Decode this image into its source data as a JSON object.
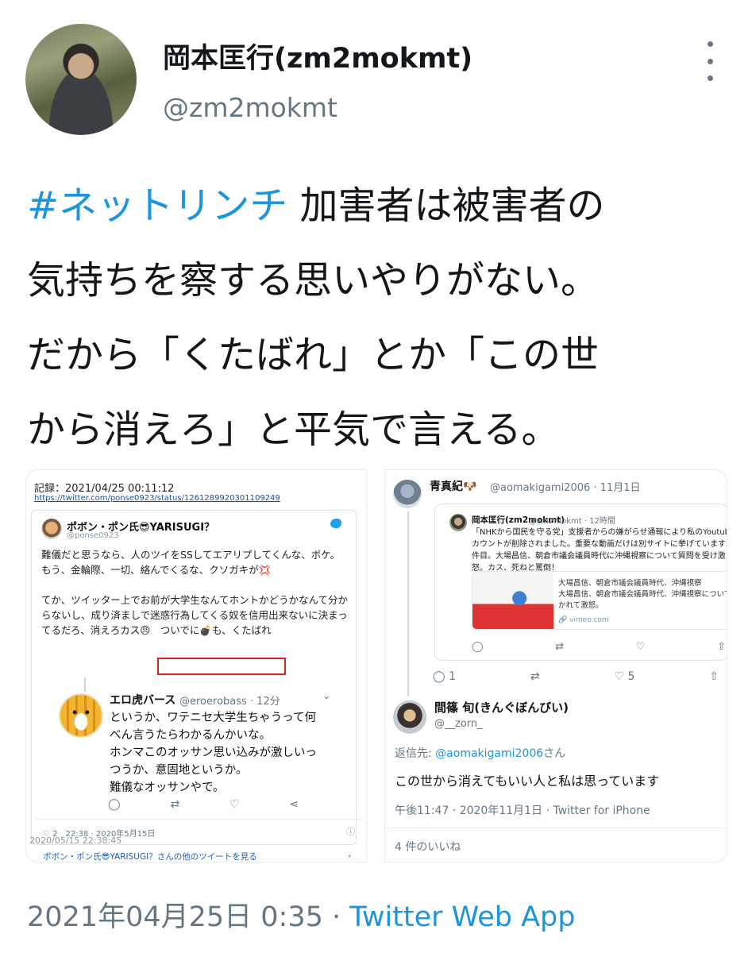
{
  "author": {
    "name": "岡本匡行(zm2mokmt)",
    "handle": "@zm2mokmt"
  },
  "tweet": {
    "hashtag": "#ネットリンチ",
    "lines": [
      " 加害者は被害者の",
      "気持ちを察する思いやりがない。",
      "だから「くたばれ」とか「この世",
      "から消えろ」と平気で言える。"
    ]
  },
  "left_image": {
    "record_title": "記録：2021/04/25 00:11:12",
    "record_url": "https://twitter.com/ponse0923/status/1261289920301109249",
    "pobo_name": "ポボン・ポン氏😎YARISUGI？",
    "pobo_handle": "@ponse0923",
    "pobo_lines": [
      "難儀だと思うなら、人のツイをSSしてエアリプしてくんな、ボケ。",
      "もう、金輪際、一切、絡んでくるな、クソガキが💢",
      "",
      "てか、ツイッター上でお前が大学生なんてホントかどうかなんて分か",
      "らないし、成り済ましで迷惑行為してくる奴を信用出来ないに決まっ",
      "てるだろ、消えろカス😠　ついでに💣も、くたばれ"
    ],
    "ero_name": "エロ虎バース",
    "ero_handle": "@eroerobass · 12分",
    "ero_lines": [
      "というか、ワテニセ大学生ちゃうって何",
      "べん言うたらわかるんかいな。",
      "ホンマこのオッサン思い込みが激しいっ",
      "つうか、意固地というか。",
      "難儀なオッサンやで。"
    ],
    "meta": "♡ 2　22:38 · 2020年5月15日",
    "more_tweets": "ポボン・ポン氏😎YARISUGI？さんの他のツイートを見る",
    "timestamp": "2020/05/15 22:38:45"
  },
  "right_image": {
    "ao_name": "青真紀🐶",
    "ao_handle": "@aomakigami2006 · 11月1日",
    "quote_name": "岡本匡行(zm2mokmt)",
    "quote_handle": "@zm2mokmt · 12時間",
    "quote_lines": [
      "「NHKから国民を守る党」支援者からの嫌がらせ通報により私のYoutube",
      "カウントが削除されました。重要な動画だけは別サイトに挙げています",
      "件目。大場昌信、朝倉市議会議員時代に沖縄視察について質問を受け激",
      "怒。カス、死ねと罵倒！"
    ],
    "link_lines": [
      "大場昌信、朝倉市議会議員時代、沖縄視察",
      "大場昌信、朝倉市議会議員時代、沖縄視察について",
      "かれて激怒。"
    ],
    "link_domain": "🔗 vimeo.com",
    "reply_count": "1",
    "like_count": "5",
    "zorn_name": "間篠 旬(きんぐぼんびい)",
    "zorn_handle": "@__zorn_",
    "reply_prefix": "返信先: ",
    "reply_to": "@aomakigami2006",
    "reply_suffix": "さん",
    "zorn_body": "この世から消えてもいい人と私は思っています",
    "zorn_meta": "午後11:47 · 2020年11月1日 · Twitter for iPhone",
    "likes": "4 件のいいね"
  },
  "footer": {
    "date": "2021年04月25日 0:35 · ",
    "app": "Twitter Web App"
  },
  "icons": [
    "more-icon",
    "twitter-bird-icon",
    "reply-icon",
    "retweet-icon",
    "like-icon",
    "share-icon",
    "chevron-down-icon",
    "info-icon"
  ]
}
